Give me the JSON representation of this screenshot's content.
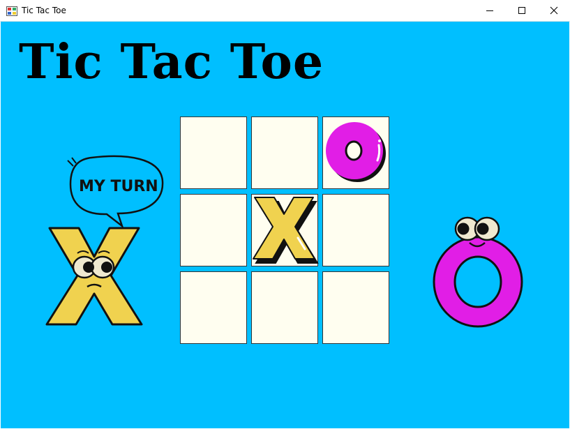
{
  "window": {
    "title": "Tic Tac Toe",
    "controls": [
      "minimize",
      "maximize",
      "close"
    ]
  },
  "game": {
    "heading": "Tic Tac Toe",
    "current_turn_label": "MY TURN",
    "current_turn_player": "X",
    "board": [
      [
        "",
        "",
        "O"
      ],
      [
        "",
        "X",
        ""
      ],
      [
        "",
        "",
        ""
      ]
    ]
  },
  "colors": {
    "background": "#00bfff",
    "cell": "#fffef0",
    "x_piece": "#f0d24f",
    "o_piece": "#e11ee6",
    "outline": "#111111"
  },
  "icons": [
    "app-icon",
    "minimize-icon",
    "maximize-icon",
    "close-icon",
    "speech-bubble-icon",
    "x-character-icon",
    "o-character-icon"
  ]
}
